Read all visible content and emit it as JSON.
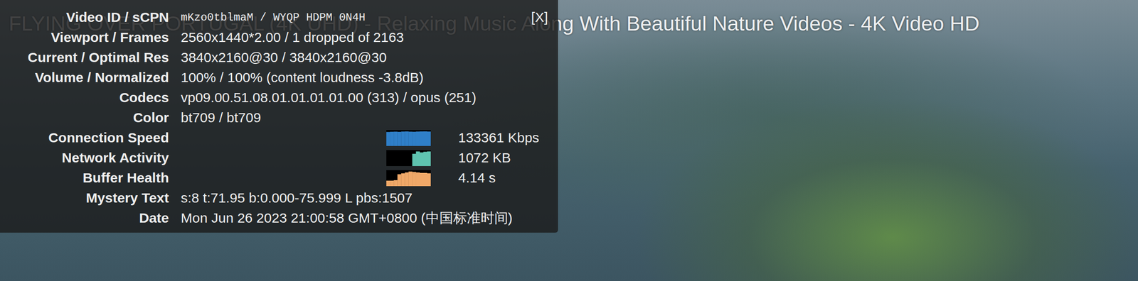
{
  "player": {
    "title": "FLYING OVER PORTUGAL (4K UHD) - Relaxing Music Along With Beautiful Nature Videos - 4K Video HD"
  },
  "stats_panel": {
    "close": "[X]",
    "rows": [
      {
        "kind": "mono",
        "label": "Video ID / sCPN",
        "value": "mKzo0tblmaM / WYQP HDPM 0N4H"
      },
      {
        "kind": "text",
        "label": "Viewport / Frames",
        "value": "2560x1440*2.00 / 1 dropped of 2163"
      },
      {
        "kind": "text",
        "label": "Current / Optimal Res",
        "value": "3840x2160@30 / 3840x2160@30"
      },
      {
        "kind": "text",
        "label": "Volume / Normalized",
        "value": "100% / 100% (content loudness -3.8dB)"
      },
      {
        "kind": "text",
        "label": "Codecs",
        "value": "vp09.00.51.08.01.01.01.01.00 (313) / opus (251)"
      },
      {
        "kind": "text",
        "label": "Color",
        "value": "bt709 / bt709"
      },
      {
        "kind": "graph",
        "label": "Connection Speed",
        "reading": "133361 Kbps",
        "color": "#2f7fc8",
        "values": [
          128000,
          130000,
          131000,
          129000,
          132000,
          133000,
          131000,
          130000,
          132000,
          133000,
          133361,
          132000
        ]
      },
      {
        "kind": "graph",
        "label": "Network Activity",
        "reading": "1072 KB",
        "color": "#5fc4b0",
        "values": [
          0,
          0,
          0,
          0,
          0,
          0,
          0,
          900,
          1072,
          1000,
          1050,
          1072
        ]
      },
      {
        "kind": "graph",
        "label": "Buffer Health",
        "reading": "4.14 s",
        "color": "#f0a868",
        "values": [
          1.2,
          1.2,
          1.3,
          2.6,
          2.8,
          3.0,
          3.2,
          3.1,
          3.0,
          2.9,
          2.9,
          2.8
        ]
      },
      {
        "kind": "text",
        "label": "Mystery Text",
        "value": "s:8 t:71.95 b:0.000-75.999 L pbs:1507"
      },
      {
        "kind": "text",
        "label": "Date",
        "value": "Mon Jun 26 2023 21:00:58 GMT+0800 (中国标准时间)"
      }
    ]
  }
}
